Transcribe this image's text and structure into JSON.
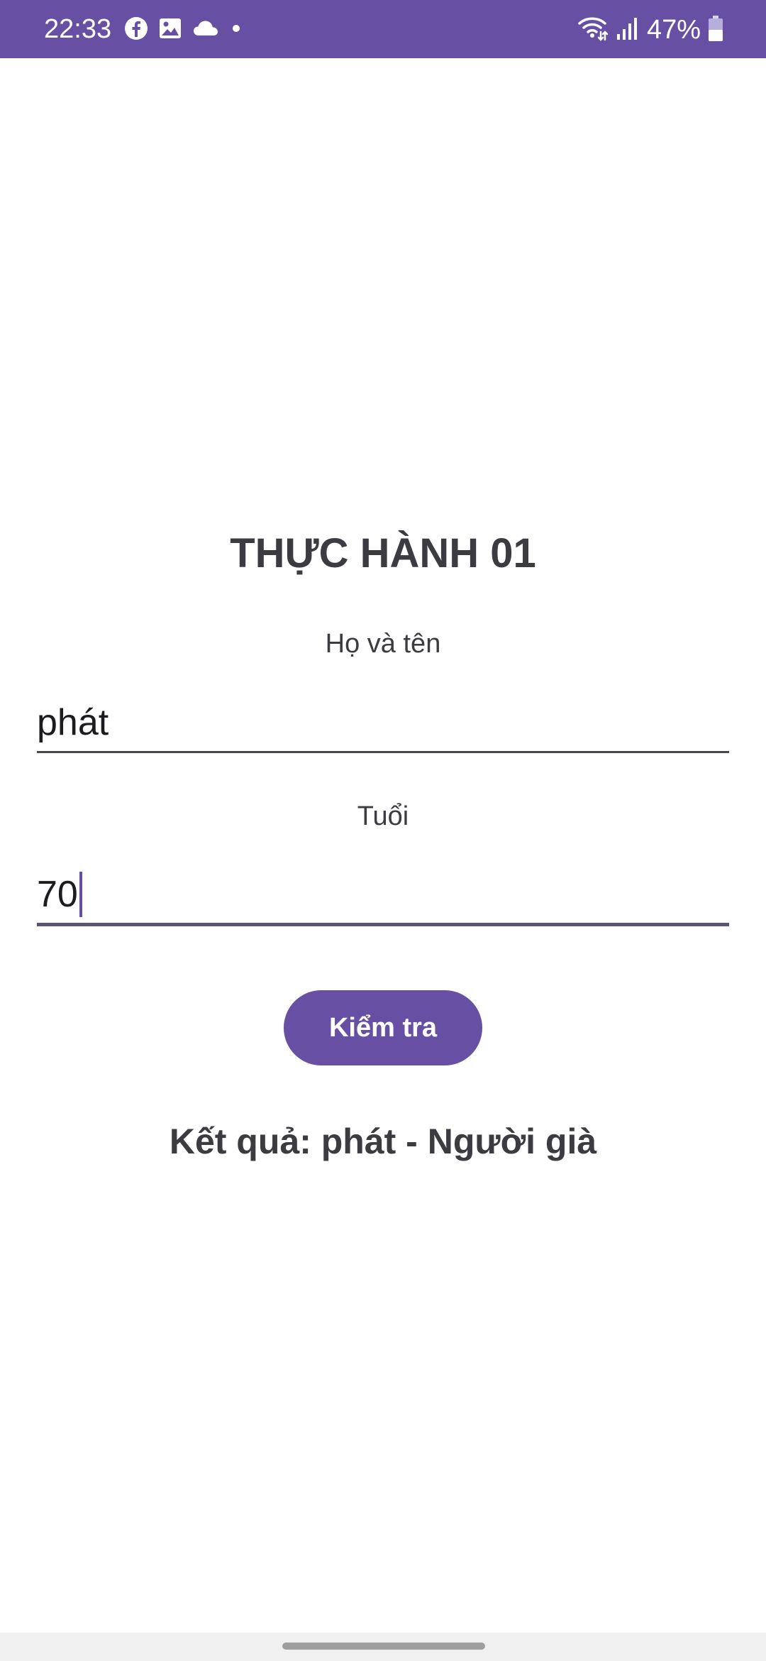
{
  "status_bar": {
    "time": "22:33",
    "battery": "47%",
    "left_icons": [
      "facebook-icon",
      "gallery-icon",
      "cloud-icon",
      "dot-icon"
    ],
    "right_icons": [
      "wifi-icon",
      "signal-icon",
      "battery-icon"
    ],
    "background": "#6750A4"
  },
  "main": {
    "title": "THỰC HÀNH 01",
    "name_label": "Họ và tên",
    "name_value": "phát",
    "age_label": "Tuổi",
    "age_value": "70",
    "check_button": "Kiểm tra",
    "result": "Kết quả: phát - Người già"
  },
  "colors": {
    "accent": "#6750A4",
    "text": "#3d3b42"
  }
}
